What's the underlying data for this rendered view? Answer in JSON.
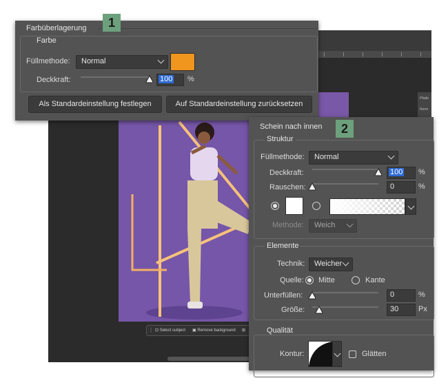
{
  "badges": {
    "one": "1",
    "two": "2"
  },
  "farbe_panel": {
    "title": "Farbüberlagerung",
    "group": "Farbe",
    "fill_label": "Füllmethode:",
    "fill_value": "Normal",
    "opacity_label": "Deckkraft:",
    "opacity_value": "100",
    "opacity_percent": 1.0,
    "percent": "%",
    "color": "#f0951e",
    "btn_default": "Als Standardeinstellung festlegen",
    "btn_reset": "Auf Standardeinstellung zurücksetzen"
  },
  "schein_panel": {
    "title": "Schein nach innen",
    "struktur": "Struktur",
    "fill_label": "Füllmethode:",
    "fill_value": "Normal",
    "opacity_label": "Deckkraft:",
    "opacity_value": "100",
    "opacity_percent": 1.0,
    "noise_label": "Rauschen:",
    "noise_value": "0",
    "noise_percent": 0.0,
    "percent": "%",
    "method_label": "Methode:",
    "method_value": "Weich",
    "elemente": "Elemente",
    "technik_label": "Technik:",
    "technik_value": "Weicher",
    "quelle_label": "Quelle:",
    "quelle_mitte": "Mitte",
    "quelle_kante": "Kante",
    "unterfuellen_label": "Unterfüllen:",
    "unterfuellen_value": "0",
    "unterfuellen_percent": 0.0,
    "groesse_label": "Größe:",
    "groesse_value": "30",
    "groesse_percent": 0.1,
    "px": "Px",
    "qualitaet": "Qualität",
    "kontur_label": "Kontur:",
    "glaetten_label": "Glätten"
  },
  "taskbar": {
    "select_subject": "Select subject",
    "remove_background": "Remove background"
  },
  "sidepanel": {
    "item1": "Pfade",
    "item2": "Norm"
  }
}
